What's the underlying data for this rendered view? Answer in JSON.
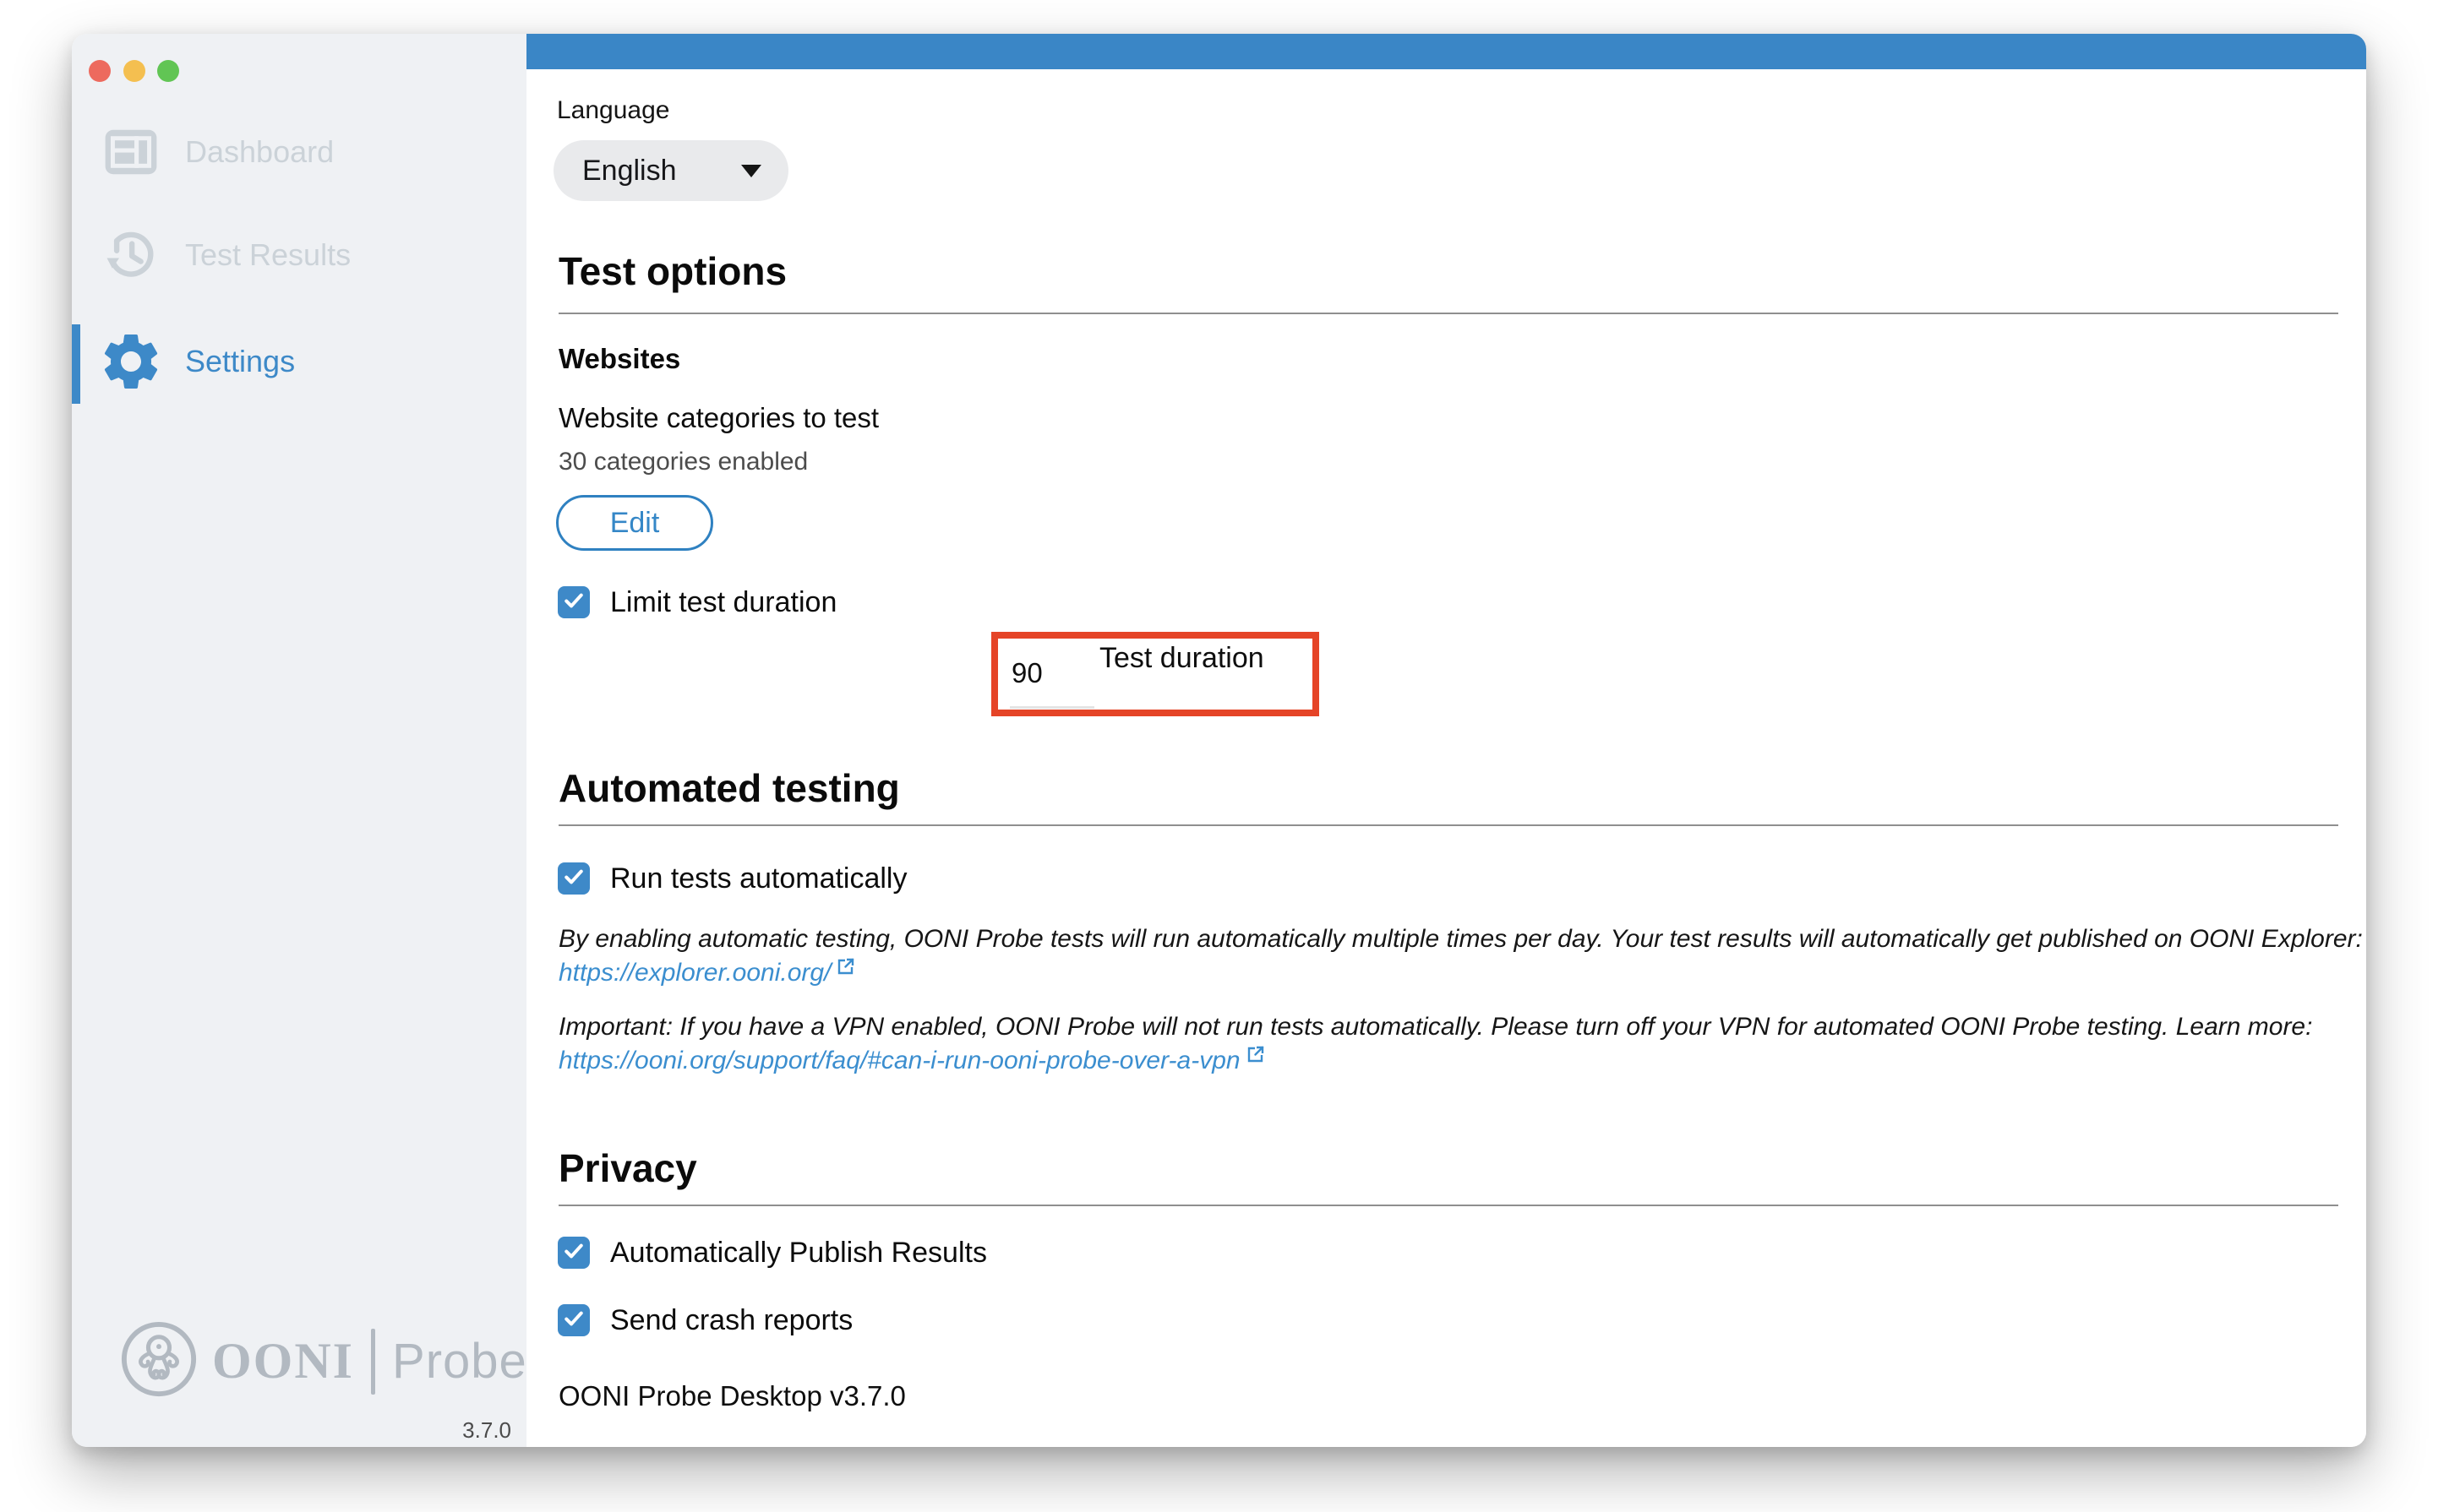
{
  "colors": {
    "accent": "#3a86c6",
    "checkbox": "#3e89c8",
    "sidebar_active": "#3d89c8",
    "link": "#3b8ecf",
    "annotation": "#e54427",
    "traffic_red": "#ed6a5e",
    "traffic_yellow": "#f4bf50",
    "traffic_green": "#61c554"
  },
  "sidebar": {
    "items": [
      {
        "label": "Dashboard",
        "active": false
      },
      {
        "label": "Test Results",
        "active": false
      },
      {
        "label": "Settings",
        "active": true
      }
    ],
    "logo": {
      "wordmark": "OONI",
      "divider": "|",
      "product": "Probe",
      "version": "3.7.0"
    }
  },
  "settings": {
    "language": {
      "label": "Language",
      "selected": "English"
    },
    "test_options": {
      "heading": "Test options",
      "websites_subheading": "Websites",
      "categories_label": "Website categories to test",
      "categories_status": "30 categories enabled",
      "edit_button": "Edit",
      "limit_checkbox": "Limit test duration",
      "limit_checked": true,
      "duration": {
        "label": "Test duration",
        "value": "90"
      }
    },
    "automated": {
      "heading": "Automated testing",
      "run_checkbox": "Run tests automatically",
      "run_checked": true,
      "explorer_note": "By enabling automatic testing, OONI Probe tests will run automatically multiple times per day. Your test results will automatically get published on OONI Explorer:",
      "explorer_link": "https://explorer.ooni.org/",
      "vpn_note": "Important: If you have a VPN enabled, OONI Probe will not run tests automatically. Please turn off your VPN for automated OONI Probe testing. Learn more:",
      "vpn_link": "https://ooni.org/support/faq/#can-i-run-ooni-probe-over-a-vpn"
    },
    "privacy": {
      "heading": "Privacy",
      "publish_checkbox": "Automatically Publish Results",
      "publish_checked": true,
      "crash_checkbox": "Send crash reports",
      "crash_checked": true,
      "app_version_line": "OONI Probe Desktop v3.7.0"
    }
  }
}
